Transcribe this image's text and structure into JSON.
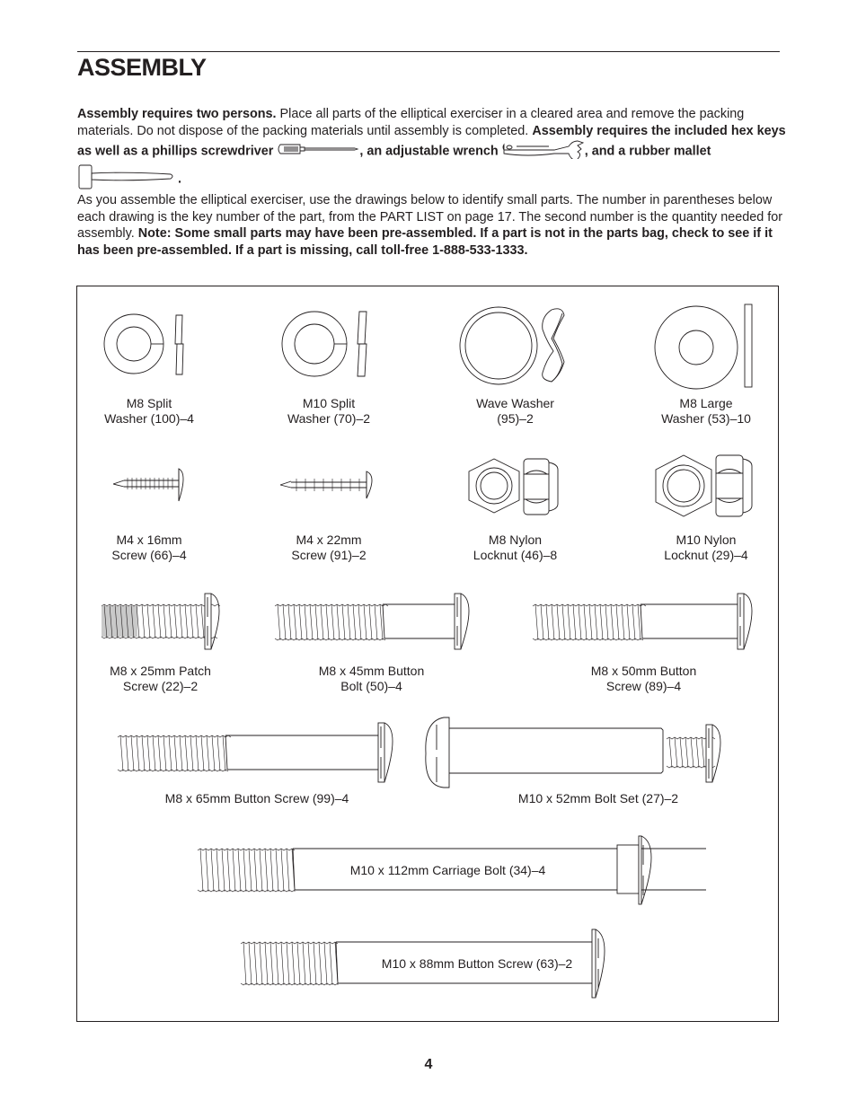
{
  "page": {
    "title": "ASSEMBLY",
    "page_number": "4"
  },
  "intro": {
    "p1_bold1": "Assembly requires two persons.",
    "p1_text1": " Place all parts of the elliptical exerciser in a cleared area and remove the packing materials. Do not dispose of the packing materials until assembly is completed. ",
    "p1_bold2": "Assembly requires the included hex keys as well as a phillips screwdriver",
    "p1_bold3": ", an adjustable wrench",
    "p1_bold4": ", and a rubber mallet",
    "p1_bold5": ".",
    "tools": [
      "phillips-screwdriver-icon",
      "adjustable-wrench-icon",
      "rubber-mallet-icon"
    ],
    "p2_text": "As you assemble the elliptical exerciser, use the drawings below to identify small parts. The number in parentheses below each drawing is the key number of the part, from the PART LIST on page 17. The second number is the quantity needed for assembly. ",
    "p2_bold": "Note: Some small parts may have been pre-assembled. If a part is not in the parts bag, check to see if it has been pre-assembled. If a part is missing, call toll-free 1-888-533-1333."
  },
  "parts": [
    {
      "label": "M8 Split\nWasher (100)–4",
      "name": "M8 Split Washer",
      "key": 100,
      "qty": 4
    },
    {
      "label": "M10 Split\nWasher (70)–2",
      "name": "M10 Split Washer",
      "key": 70,
      "qty": 2
    },
    {
      "label": "Wave Washer\n(95)–2",
      "name": "Wave Washer",
      "key": 95,
      "qty": 2
    },
    {
      "label": "M8 Large\nWasher (53)–10",
      "name": "M8 Large Washer",
      "key": 53,
      "qty": 10
    },
    {
      "label": "M4 x 16mm\nScrew (66)–4",
      "name": "M4 x 16mm Screw",
      "key": 66,
      "qty": 4
    },
    {
      "label": "M4 x 22mm\nScrew (91)–2",
      "name": "M4 x 22mm Screw",
      "key": 91,
      "qty": 2
    },
    {
      "label": "M8 Nylon\nLocknut (46)–8",
      "name": "M8 Nylon Locknut",
      "key": 46,
      "qty": 8
    },
    {
      "label": "M10 Nylon\nLocknut (29)–4",
      "name": "M10 Nylon Locknut",
      "key": 29,
      "qty": 4
    },
    {
      "label": "M8 x 25mm Patch\nScrew (22)–2",
      "name": "M8 x 25mm Patch Screw",
      "key": 22,
      "qty": 2
    },
    {
      "label": "M8 x 45mm Button\nBolt (50)–4",
      "name": "M8 x 45mm Button Bolt",
      "key": 50,
      "qty": 4
    },
    {
      "label": "M8 x 50mm Button\nScrew (89)–4",
      "name": "M8 x 50mm Button Screw",
      "key": 89,
      "qty": 4
    },
    {
      "label": "M8 x 65mm Button Screw (99)–4",
      "name": "M8 x 65mm Button Screw",
      "key": 99,
      "qty": 4
    },
    {
      "label": "M10 x 52mm Bolt Set (27)–2",
      "name": "M10 x 52mm Bolt Set",
      "key": 27,
      "qty": 2
    },
    {
      "label": "M10 x 112mm Carriage Bolt (34)–4",
      "name": "M10 x 112mm Carriage Bolt",
      "key": 34,
      "qty": 4
    },
    {
      "label": "M10 x 88mm Button Screw (63)–2",
      "name": "M10 x 88mm Button Screw",
      "key": 63,
      "qty": 2
    }
  ]
}
